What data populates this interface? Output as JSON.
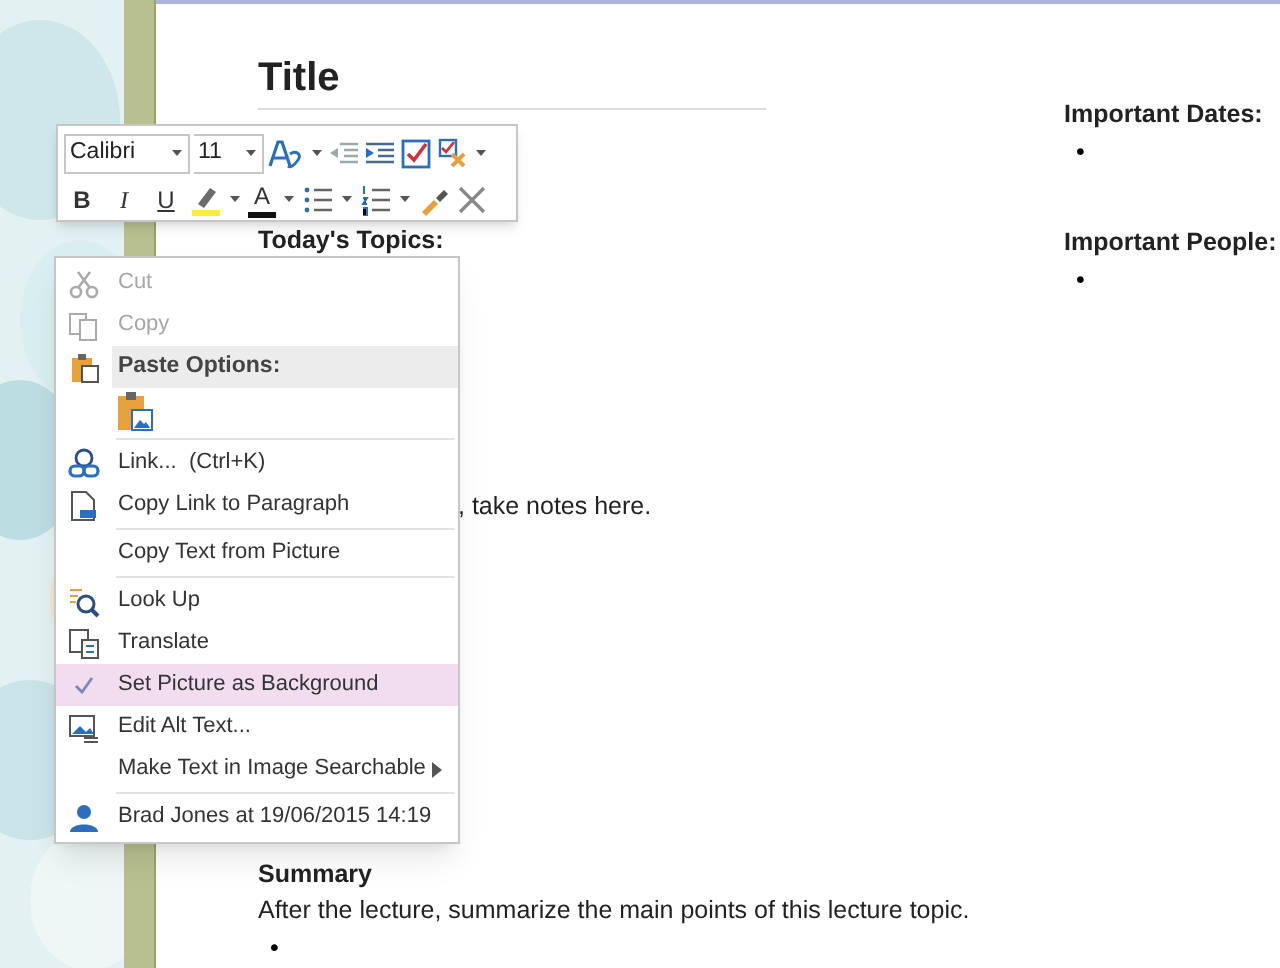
{
  "page": {
    "title": "Title",
    "topics_heading": "Today's Topics:",
    "notes_fragment": ", take notes here.",
    "summary_heading": "Summary",
    "summary_text": "After the lecture, summarize the main points of this lecture topic.",
    "summary_bullets": [
      "•"
    ],
    "side_sections": [
      {
        "heading": "Important Dates:",
        "bullets": [
          "•"
        ]
      },
      {
        "heading": "Important People:",
        "bullets": [
          "•"
        ]
      }
    ]
  },
  "toolbar": {
    "font": "Calibri",
    "size": "11",
    "row_1": [
      {
        "kind": "styles",
        "dropdown": true
      },
      {
        "kind": "outdent",
        "dropdown": false
      },
      {
        "kind": "indent",
        "dropdown": false
      },
      {
        "kind": "todo",
        "dropdown": false
      },
      {
        "kind": "tag",
        "dropdown": true
      }
    ],
    "row_2": [
      {
        "kind": "bold",
        "label": "B",
        "dropdown": false
      },
      {
        "kind": "italic",
        "label": "I",
        "dropdown": false
      },
      {
        "kind": "underline",
        "label": "U",
        "dropdown": false
      },
      {
        "kind": "highlight",
        "dropdown": true
      },
      {
        "kind": "font_color",
        "label": "A",
        "dropdown": true
      },
      {
        "kind": "bullets",
        "dropdown": true
      },
      {
        "kind": "numbering",
        "dropdown": true
      },
      {
        "kind": "painter",
        "dropdown": false
      },
      {
        "kind": "clear",
        "dropdown": false
      }
    ]
  },
  "context_menu": [
    {
      "kind": "cut",
      "label": "Cut",
      "disabled": true,
      "selected": false,
      "checked": false,
      "submenu": false
    },
    {
      "kind": "copy",
      "label": "Copy",
      "disabled": true,
      "selected": false,
      "checked": false,
      "submenu": false
    },
    {
      "kind": "header",
      "label": "Paste Options:"
    },
    {
      "kind": "paste_picture"
    },
    {
      "kind": "separator"
    },
    {
      "kind": "link",
      "label": "Link...  (Ctrl+K)",
      "disabled": false,
      "selected": false,
      "checked": false,
      "submenu": false
    },
    {
      "kind": "copy_link",
      "label": "Copy Link to Paragraph",
      "disabled": false,
      "selected": false,
      "checked": false,
      "submenu": false
    },
    {
      "kind": "separator"
    },
    {
      "kind": "plain",
      "label": "Copy Text from Picture",
      "disabled": false,
      "selected": false,
      "checked": false,
      "submenu": false
    },
    {
      "kind": "separator"
    },
    {
      "kind": "lookup",
      "label": "Look Up",
      "disabled": false,
      "selected": false,
      "checked": false,
      "submenu": false
    },
    {
      "kind": "translate",
      "label": "Translate",
      "disabled": false,
      "selected": false,
      "checked": false,
      "submenu": false
    },
    {
      "kind": "plain",
      "label": "Set Picture as Background",
      "disabled": false,
      "selected": true,
      "checked": true,
      "submenu": false
    },
    {
      "kind": "alt_text",
      "label": "Edit Alt Text...",
      "disabled": false,
      "selected": false,
      "checked": false,
      "submenu": false
    },
    {
      "kind": "plain",
      "label": "Make Text in Image Searchable",
      "disabled": false,
      "selected": false,
      "checked": false,
      "submenu": true
    },
    {
      "kind": "separator"
    },
    {
      "kind": "author",
      "label": "Brad Jones at 19/06/2015 14:19",
      "disabled": false,
      "selected": false,
      "checked": false,
      "submenu": false
    }
  ]
}
